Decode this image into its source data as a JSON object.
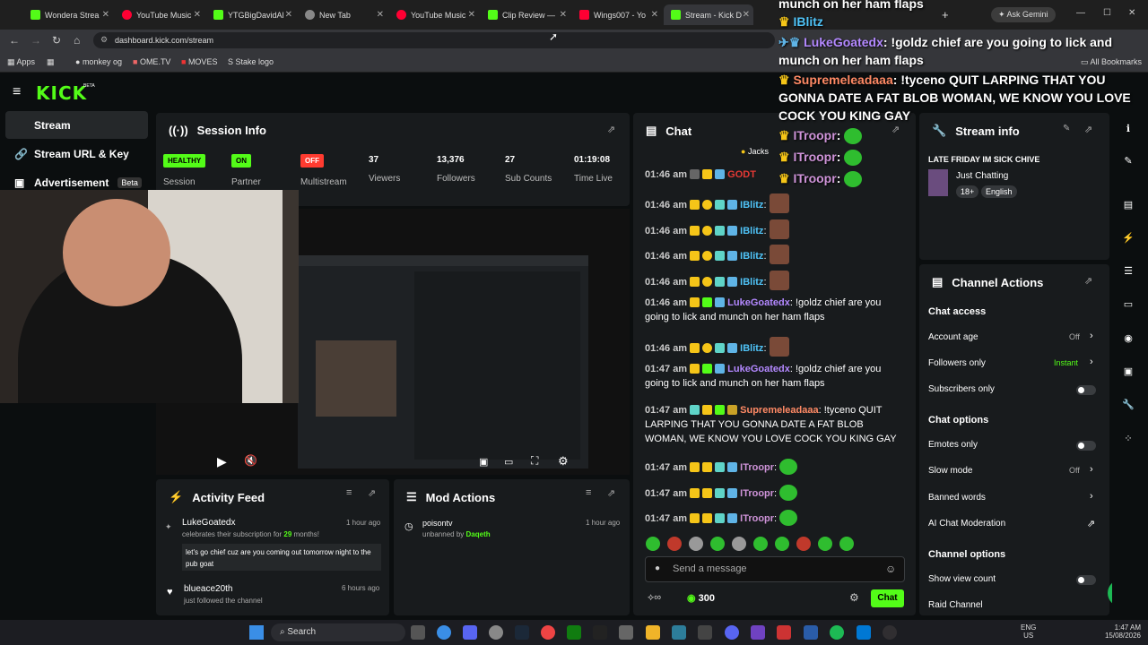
{
  "browser": {
    "tabs": [
      {
        "title": "Wondera Strea",
        "color": "#53fc18"
      },
      {
        "title": "YouTube Music",
        "color": "#ff0033"
      },
      {
        "title": "YTGBigDavidAl",
        "color": "#53fc18"
      },
      {
        "title": "New Tab",
        "color": "#888888"
      },
      {
        "title": "YouTube Music",
        "color": "#ff0033"
      },
      {
        "title": "Clip Review —",
        "color": "#53fc18"
      },
      {
        "title": "Wings007 - Yo",
        "color": "#ff0033"
      },
      {
        "title": "Stream - Kick D",
        "color": "#53fc18"
      }
    ],
    "ask_gemini": "Ask Gemini",
    "url": "dashboard.kick.com/stream",
    "bookmarks": [
      "Apps",
      "monkey og",
      "OME.TV",
      "MOVES",
      "Stake logo"
    ],
    "all_bookmarks": "All Bookmarks"
  },
  "kick": {
    "logo": "KICK",
    "logo_beta": "BETA",
    "sidebar": [
      {
        "label": "Stream",
        "icon": "stream-icon"
      },
      {
        "label": "Stream URL & Key",
        "icon": "link-icon"
      },
      {
        "label": "Advertisement",
        "icon": "ad-icon",
        "badge": "Beta"
      }
    ],
    "session": {
      "title": "Session Info",
      "stats": [
        {
          "badge": "HEALTHY",
          "label": "Session",
          "color": "#53fc18"
        },
        {
          "badge": "ON",
          "label": "Partner",
          "color": "#53fc18"
        },
        {
          "badge": "OFF",
          "label": "Multistream",
          "color": "#ff3b30"
        },
        {
          "value": "37",
          "label": "Viewers"
        },
        {
          "value": "13,376",
          "label": "Followers"
        },
        {
          "value": "27",
          "label": "Sub Counts"
        },
        {
          "value": "01:19:08",
          "label": "Time Live"
        }
      ]
    },
    "activity": {
      "title": "Activity Feed",
      "items": [
        {
          "user": "LukeGoatedx",
          "time": "1 hour ago",
          "desc_pre": "celebrates their subscription for ",
          "desc_num": "29",
          "desc_post": " months!",
          "message": "let's go chief cuz are you coming out tomorrow night to the pub goat"
        },
        {
          "user": "blueace20th",
          "time": "6 hours ago",
          "desc": "just followed the channel"
        }
      ]
    },
    "mod_actions": {
      "title": "Mod Actions",
      "items": [
        {
          "user": "poisontv",
          "time": "1 hour ago",
          "action": "unbanned by",
          "by": "Daqeth"
        }
      ]
    },
    "chat": {
      "title": "Chat",
      "pinned_user": "Jacks",
      "top_user": "GODT",
      "messages": [
        {
          "time": "01:46 am",
          "user": "IBlitz",
          "color": "#4fc3f7",
          "text": ""
        },
        {
          "time": "01:46 am",
          "user": "IBlitz",
          "color": "#4fc3f7",
          "text": ""
        },
        {
          "time": "01:46 am",
          "user": "IBlitz",
          "color": "#4fc3f7",
          "text": ""
        },
        {
          "time": "01:46 am",
          "user": "IBlitz",
          "color": "#4fc3f7",
          "text": ""
        },
        {
          "time": "01:46 am",
          "user": "LukeGoatedx",
          "color": "#b388ff",
          "text": "!goldz chief are you going to lick and munch on her ham flaps"
        },
        {
          "time": "01:46 am",
          "user": "IBlitz",
          "color": "#4fc3f7",
          "text": ""
        },
        {
          "time": "01:47 am",
          "user": "LukeGoatedx",
          "color": "#b388ff",
          "text": "!goldz chief are you going to lick and munch on her ham flaps"
        },
        {
          "time": "01:47 am",
          "user": "Supremeleadaaa",
          "color": "#ff8a65",
          "text": "!tyceno QUIT LARPING THAT YOU GONNA DATE A FAT BLOB WOMAN, WE KNOW YOU LOVE COCK YOU KING GAY"
        },
        {
          "time": "01:47 am",
          "user": "ITroopr",
          "color": "#ce93d8",
          "text": ""
        },
        {
          "time": "01:47 am",
          "user": "ITroopr",
          "color": "#ce93d8",
          "text": ""
        },
        {
          "time": "01:47 am",
          "user": "ITroopr",
          "color": "#ce93d8",
          "text": ""
        }
      ],
      "input_placeholder": "Send a message",
      "points": "300",
      "send_label": "Chat"
    },
    "overlay_chat": {
      "lines": [
        {
          "user": "IBlitz",
          "text": ""
        },
        {
          "user": "LukeGoatedx",
          "text": "!goldz chief are you going to lick and munch on her ham flaps"
        },
        {
          "user": "Supremeleadaaa",
          "text": "!tyceno QUIT LARPING THAT YOU GONNA DATE A FAT BLOB WOMAN, WE KNOW YOU LOVE COCK YOU KING GAY"
        },
        {
          "user": "ITroopr",
          "text": ""
        },
        {
          "user": "ITroopr",
          "text": ""
        },
        {
          "user": "ITroopr",
          "text": ""
        }
      ],
      "top_text": "munch on her ham flaps"
    },
    "stream_info": {
      "title": "Stream info",
      "stream_title": "LATE FRIDAY IM SICK CHIVE",
      "category": "Just Chatting",
      "tags": [
        "18+",
        "English"
      ]
    },
    "channel_actions": {
      "title": "Channel Actions",
      "chat_access_title": "Chat access",
      "account_age": {
        "label": "Account age",
        "value": "Off"
      },
      "followers_only": {
        "label": "Followers only",
        "value": "Instant"
      },
      "subscribers_only": {
        "label": "Subscribers only"
      },
      "chat_options_title": "Chat options",
      "emotes_only": {
        "label": "Emotes only"
      },
      "slow_mode": {
        "label": "Slow mode",
        "value": "Off"
      },
      "banned_words": {
        "label": "Banned words"
      },
      "ai_moderation": {
        "label": "AI Chat Moderation"
      },
      "channel_options_title": "Channel options",
      "show_view_count": {
        "label": "Show view count"
      },
      "raid_channel": {
        "label": "Raid Channel"
      }
    }
  },
  "taskbar": {
    "search": "Search",
    "lang1": "ENG",
    "lang2": "US",
    "time": "1:47 AM",
    "date": "15/08/2026"
  }
}
